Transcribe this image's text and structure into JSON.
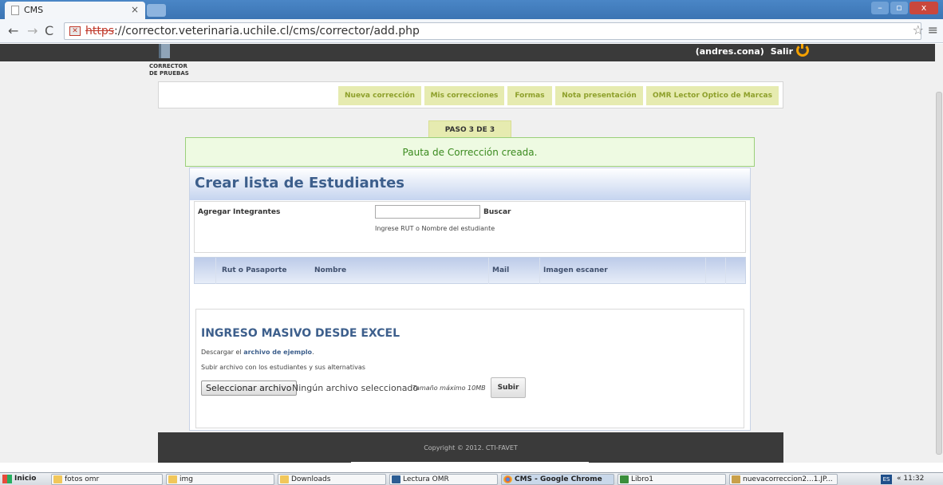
{
  "browser": {
    "tab_title": "CMS",
    "tab_close": "×",
    "url_scheme": "https",
    "url_rest": "://corrector.veterinaria.uchile.cl/cms/corrector/add.php",
    "window_minimize": "–",
    "window_maximize": "▫",
    "window_close": "x"
  },
  "header": {
    "user_label": "(andres.cona)",
    "logout_label": "Salir",
    "logo_line1": "CORRECTOR",
    "logo_line2": "DE PRUEBAS"
  },
  "nav": {
    "items": [
      {
        "label": "Nueva corrección"
      },
      {
        "label": "Mis correcciones"
      },
      {
        "label": "Formas"
      },
      {
        "label": "Nota presentación"
      },
      {
        "label": "OMR Lector Optico de Marcas"
      }
    ]
  },
  "step": {
    "label": "PASO 3 DE 3"
  },
  "alert": {
    "message": "Pauta de Corrección creada."
  },
  "panel": {
    "title": "Crear lista de Estudiantes",
    "add_members_label": "Agregar Integrantes",
    "search_value": "",
    "search_button": "Buscar",
    "search_hint": "Ingrese RUT o Nombre del estudiante",
    "table": {
      "columns": [
        "Rut o Pasaporte",
        "Nombre",
        "Mail",
        "Imagen escaner"
      ]
    }
  },
  "excel": {
    "title": "INGRESO MASIVO DESDE EXCEL",
    "download_prefix": "Descargar el ",
    "download_link": "archivo de ejemplo",
    "download_suffix": ".",
    "upload_instructions": "Subir archivo con los estudiantes y sus alternativas",
    "choose_file_button": "Seleccionar archivo",
    "no_file_text": "Ningún archivo seleccionado",
    "max_size_text": "Tamaño máximo 10MB",
    "upload_button": "Subir"
  },
  "footer": {
    "copyright": "Copyright © 2012. CTI-FAVET"
  },
  "taskbar": {
    "start_label": "Inicio",
    "items": [
      {
        "label": "fotos omr"
      },
      {
        "label": "img"
      },
      {
        "label": "Downloads"
      },
      {
        "label": "Lectura OMR"
      },
      {
        "label": "CMS - Google Chrome"
      },
      {
        "label": "Libro1"
      },
      {
        "label": "nuevacorreccion2...1.JP..."
      }
    ],
    "language": "ES",
    "clock_prefix": "«",
    "clock": "11:32"
  },
  "colors": {
    "nav_bg": "#e6ebb0",
    "nav_text": "#8ea02b",
    "alert_bg": "#eefae2",
    "alert_text": "#3a8a1e",
    "heading_blue": "#3d5f8c",
    "power_icon": "#f5a100"
  }
}
